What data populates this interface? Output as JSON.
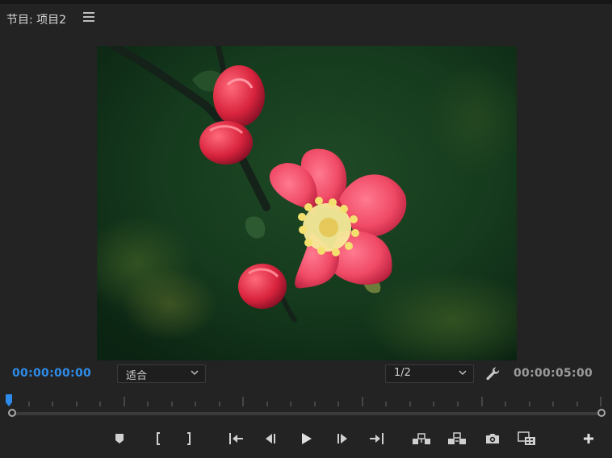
{
  "panel": {
    "title": "节目: 项目2",
    "menu_icon": "hamburger-menu-icon"
  },
  "viewer": {
    "content": "red flowering quince blossom with buds on a dark green blurred background"
  },
  "timecode": {
    "current": "00:00:00:00",
    "duration": "00:00:05:00",
    "current_color": "#2d8ceb"
  },
  "zoom_select": {
    "value": "适合"
  },
  "resolution_select": {
    "value": "1/2"
  },
  "playhead": {
    "position_seconds": 0
  },
  "transport": {
    "buttons": [
      "add-marker-icon",
      "mark-in-icon",
      "mark-out-icon",
      "go-to-in-icon",
      "step-back-icon",
      "play-icon",
      "step-forward-icon",
      "go-to-out-icon",
      "lift-icon",
      "extract-icon",
      "export-frame-icon",
      "comparison-view-icon",
      "button-editor-plus-icon"
    ]
  }
}
